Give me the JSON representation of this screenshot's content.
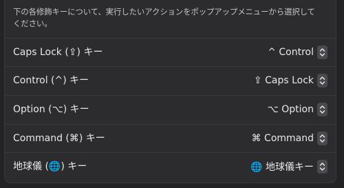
{
  "description": "下の各修飾キーについて、実行したいアクションをポップアップメニューから選択してください。",
  "rows": [
    {
      "label": "Caps Lock (⇪) キー",
      "value": "^ Control",
      "icon": "caps-lock-key"
    },
    {
      "label": "Control (^) キー",
      "value": "⇪ Caps Lock",
      "icon": "control-key"
    },
    {
      "label": "Option (⌥) キー",
      "value": "⌥ Option",
      "icon": "option-key"
    },
    {
      "label": "Command (⌘) キー",
      "value": "⌘ Command",
      "icon": "command-key"
    },
    {
      "label": "地球儀 (🌐) キー",
      "value": "🌐 地球儀キー",
      "icon": "globe-key"
    }
  ],
  "colors": {
    "background": "#232325",
    "panel": "#2c2c2e",
    "divider": "#3a3a3c",
    "stepper": "#4a4a4e",
    "text": "#e8e8ea"
  }
}
